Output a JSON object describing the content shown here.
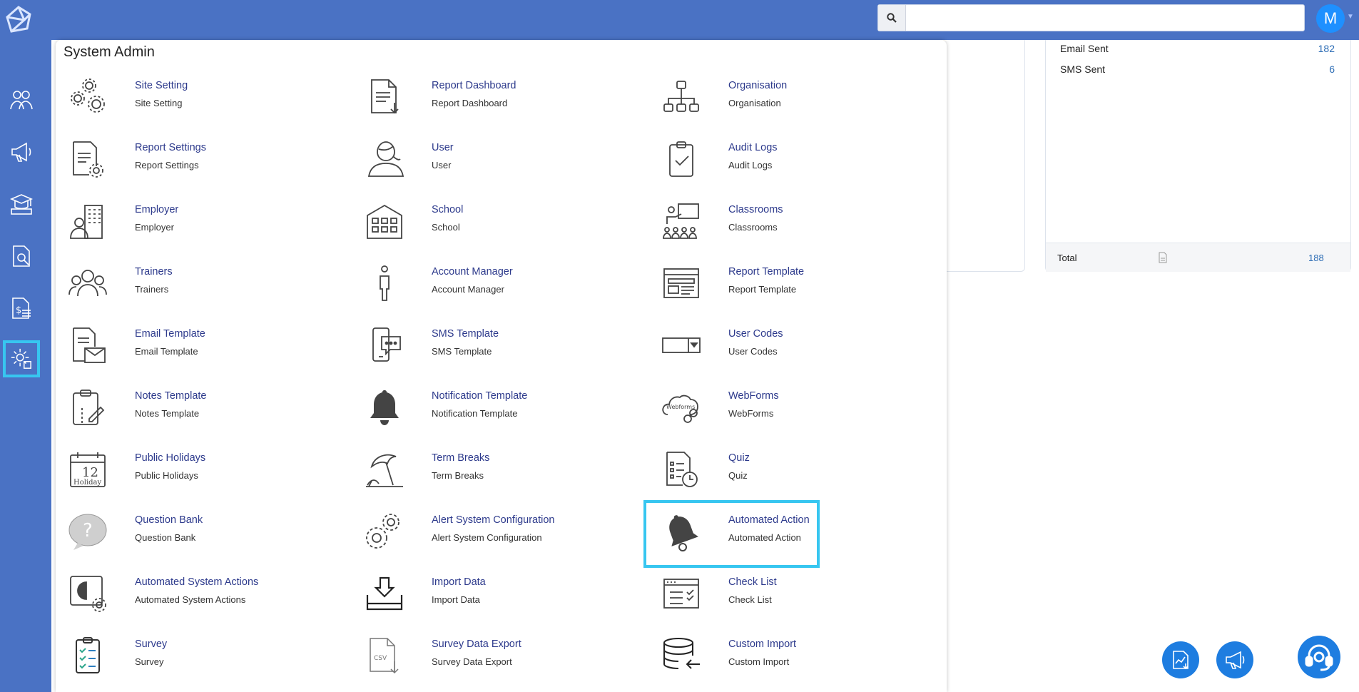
{
  "topbar": {
    "search_placeholder": "",
    "avatar_initial": "M"
  },
  "sidebar": {
    "items": [
      {
        "icon": "people-icon"
      },
      {
        "icon": "megaphone-icon"
      },
      {
        "icon": "classroom-icon"
      },
      {
        "icon": "document-search-icon"
      },
      {
        "icon": "invoice-dollar-icon"
      },
      {
        "icon": "settings-gear-icon",
        "active": true
      }
    ]
  },
  "background_stats": {
    "rows": [
      {
        "label": "Email Sent",
        "value": "182"
      },
      {
        "label": "SMS Sent",
        "value": "6"
      }
    ],
    "total_label": "Total",
    "total_value": "188"
  },
  "panel": {
    "title": "System Admin",
    "items": [
      {
        "title": "Site Setting",
        "subtitle": "Site Setting",
        "icon": "gears-icon"
      },
      {
        "title": "Report Dashboard",
        "subtitle": "Report Dashboard",
        "icon": "report-download-icon"
      },
      {
        "title": "Organisation",
        "subtitle": "Organisation",
        "icon": "org-chart-icon"
      },
      {
        "title": "Report Settings",
        "subtitle": "Report Settings",
        "icon": "report-settings-icon"
      },
      {
        "title": "User",
        "subtitle": "User",
        "icon": "user-icon"
      },
      {
        "title": "Audit Logs",
        "subtitle": "Audit Logs",
        "icon": "clipboard-check-icon"
      },
      {
        "title": "Employer",
        "subtitle": "Employer",
        "icon": "building-person-icon"
      },
      {
        "title": "School",
        "subtitle": "School",
        "icon": "school-icon"
      },
      {
        "title": "Classrooms",
        "subtitle": "Classrooms",
        "icon": "classroom-teacher-icon"
      },
      {
        "title": "Trainers",
        "subtitle": "Trainers",
        "icon": "group-icon"
      },
      {
        "title": "Account Manager",
        "subtitle": "Account Manager",
        "icon": "person-outline-icon"
      },
      {
        "title": "Report Template",
        "subtitle": "Report Template",
        "icon": "template-layout-icon"
      },
      {
        "title": "Email Template",
        "subtitle": "Email Template",
        "icon": "email-document-icon"
      },
      {
        "title": "SMS Template",
        "subtitle": "SMS Template",
        "icon": "phone-chat-icon"
      },
      {
        "title": "User Codes",
        "subtitle": "User Codes",
        "icon": "dropdown-box-icon"
      },
      {
        "title": "Notes Template",
        "subtitle": "Notes Template",
        "icon": "clipboard-pen-icon"
      },
      {
        "title": "Notification Template",
        "subtitle": "Notification Template",
        "icon": "bell-icon"
      },
      {
        "title": "WebForms",
        "subtitle": "WebForms",
        "icon": "cloud-link-icon"
      },
      {
        "title": "Public Holidays",
        "subtitle": "Public Holidays",
        "icon": "calendar-holiday-icon",
        "icon_text_day": "12",
        "icon_text_word": "Holiday"
      },
      {
        "title": "Term Breaks",
        "subtitle": "Term Breaks",
        "icon": "beach-umbrella-icon"
      },
      {
        "title": "Quiz",
        "subtitle": "Quiz",
        "icon": "quiz-timer-icon"
      },
      {
        "title": "Question Bank",
        "subtitle": "Question Bank",
        "icon": "question-bubble-icon"
      },
      {
        "title": "Alert System Configuration",
        "subtitle": "Alert System Configuration",
        "icon": "gears-alert-icon"
      },
      {
        "title": "Automated Action",
        "subtitle": "Automated Action",
        "icon": "bell-filled-icon",
        "highlighted": true
      },
      {
        "title": "Automated System Actions",
        "subtitle": "Automated System Actions",
        "icon": "system-gear-icon"
      },
      {
        "title": "Import Data",
        "subtitle": "Import Data",
        "icon": "import-tray-icon"
      },
      {
        "title": "Check List",
        "subtitle": "Check List",
        "icon": "checklist-window-icon"
      },
      {
        "title": "Survey",
        "subtitle": "Survey",
        "icon": "survey-clipboard-icon"
      },
      {
        "title": "Survey Data Export",
        "subtitle": "Survey Data Export",
        "icon": "csv-export-icon",
        "icon_text": "CSV"
      },
      {
        "title": "Custom Import",
        "subtitle": "Custom Import",
        "icon": "database-import-icon"
      }
    ]
  },
  "fabs": [
    {
      "icon": "report-chart-icon"
    },
    {
      "icon": "announcement-icon"
    },
    {
      "icon": "support-headset-icon"
    }
  ],
  "colors": {
    "brand_blue": "#4a72c4",
    "highlight": "#37c6f0",
    "link": "#2d3a8c"
  }
}
